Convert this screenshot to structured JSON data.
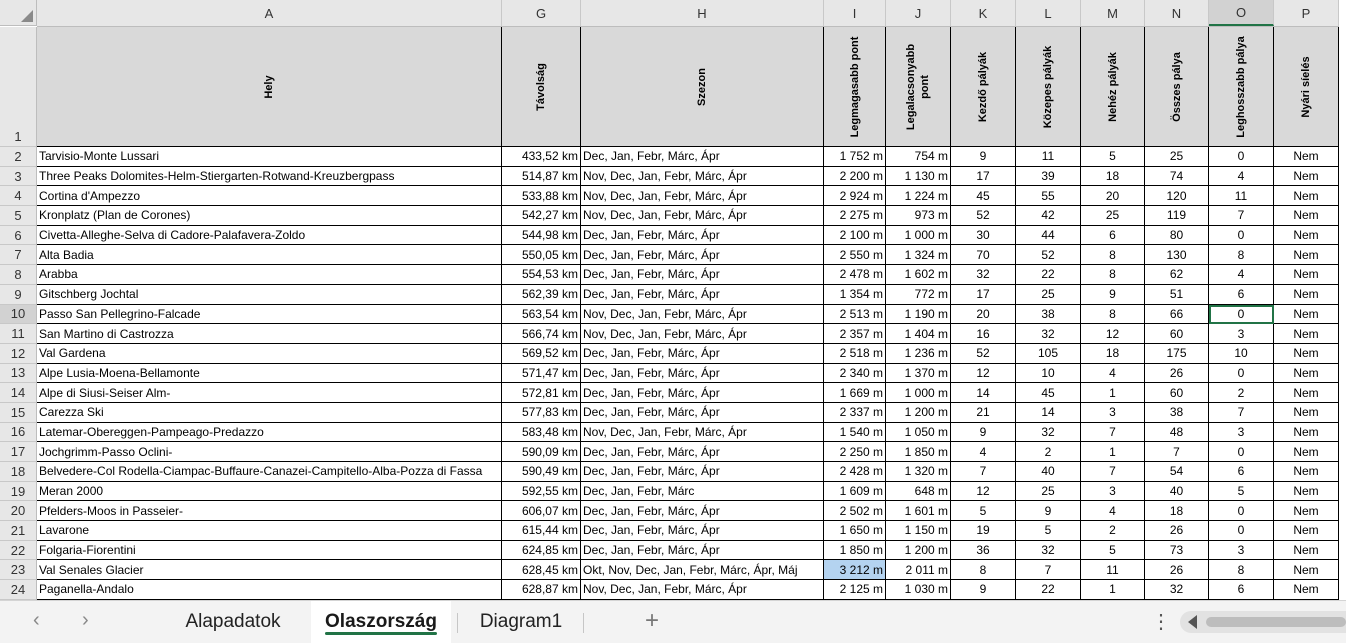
{
  "columns": [
    "A",
    "G",
    "H",
    "I",
    "J",
    "K",
    "L",
    "M",
    "N",
    "O",
    "P"
  ],
  "headers": [
    "Hely",
    "Távolság",
    "Szezon",
    "Legmagasabb pont",
    "Legalacsonyabb pont",
    "Kezdő pályák",
    "Közepes pályák",
    "Nehéz pályák",
    "Összes pálya",
    "Leghosszabb pálya",
    "Nyári síelés"
  ],
  "header_row_number": "1",
  "rows": [
    {
      "n": "2",
      "c": [
        "Tarvisio-Monte Lussari",
        "433,52 km",
        "Dec, Jan, Febr, Márc, Ápr",
        "1 752 m",
        "754 m",
        "9",
        "11",
        "5",
        "25",
        "0",
        "Nem"
      ]
    },
    {
      "n": "3",
      "c": [
        "Three Peaks Dolomites-Helm-Stiergarten-Rotwand-Kreuzbergpass",
        "514,87 km",
        "Nov, Dec, Jan, Febr, Márc, Ápr",
        "2 200 m",
        "1 130 m",
        "17",
        "39",
        "18",
        "74",
        "4",
        "Nem"
      ]
    },
    {
      "n": "4",
      "c": [
        "Cortina d'Ampezzo",
        "533,88 km",
        "Nov, Dec, Jan, Febr, Márc, Ápr",
        "2 924 m",
        "1 224 m",
        "45",
        "55",
        "20",
        "120",
        "11",
        "Nem"
      ]
    },
    {
      "n": "5",
      "c": [
        "Kronplatz (Plan de Corones)",
        "542,27 km",
        "Nov, Dec, Jan, Febr, Márc, Ápr",
        "2 275 m",
        "973 m",
        "52",
        "42",
        "25",
        "119",
        "7",
        "Nem"
      ]
    },
    {
      "n": "6",
      "c": [
        "Civetta-Alleghe-Selva di Cadore-Palafavera-Zoldo",
        "544,98 km",
        "Dec, Jan, Febr, Márc, Ápr",
        "2 100 m",
        "1 000 m",
        "30",
        "44",
        "6",
        "80",
        "0",
        "Nem"
      ]
    },
    {
      "n": "7",
      "c": [
        "Alta Badia",
        "550,05 km",
        "Dec, Jan, Febr, Márc, Ápr",
        "2 550 m",
        "1 324 m",
        "70",
        "52",
        "8",
        "130",
        "8",
        "Nem"
      ]
    },
    {
      "n": "8",
      "c": [
        "Arabba",
        "554,53 km",
        "Dec, Jan, Febr, Márc, Ápr",
        "2 478 m",
        "1 602 m",
        "32",
        "22",
        "8",
        "62",
        "4",
        "Nem"
      ]
    },
    {
      "n": "9",
      "c": [
        "Gitschberg Jochtal",
        "562,39 km",
        "Dec, Jan, Febr, Márc, Ápr",
        "1 354 m",
        "772 m",
        "17",
        "25",
        "9",
        "51",
        "6",
        "Nem"
      ]
    },
    {
      "n": "10",
      "c": [
        "Passo San Pellegrino-Falcade",
        "563,54 km",
        "Nov, Dec, Jan, Febr, Márc, Ápr",
        "2 513 m",
        "1 190 m",
        "20",
        "38",
        "8",
        "66",
        "0",
        "Nem"
      ]
    },
    {
      "n": "11",
      "c": [
        "San Martino di Castrozza",
        "566,74 km",
        "Nov, Dec, Jan, Febr, Márc, Ápr",
        "2 357 m",
        "1 404 m",
        "16",
        "32",
        "12",
        "60",
        "3",
        "Nem"
      ]
    },
    {
      "n": "12",
      "c": [
        "Val Gardena",
        "569,52 km",
        "Dec, Jan, Febr, Márc, Ápr",
        "2 518 m",
        "1 236 m",
        "52",
        "105",
        "18",
        "175",
        "10",
        "Nem"
      ]
    },
    {
      "n": "13",
      "c": [
        "Alpe Lusia-Moena-Bellamonte",
        "571,47 km",
        "Dec, Jan, Febr, Márc, Ápr",
        "2 340 m",
        "1 370 m",
        "12",
        "10",
        "4",
        "26",
        "0",
        "Nem"
      ]
    },
    {
      "n": "14",
      "c": [
        "Alpe di Siusi-Seiser Alm-",
        "572,81 km",
        "Dec, Jan, Febr, Márc, Ápr",
        "1 669 m",
        "1 000 m",
        "14",
        "45",
        "1",
        "60",
        "2",
        "Nem"
      ]
    },
    {
      "n": "15",
      "c": [
        "Carezza Ski",
        "577,83 km",
        "Dec, Jan, Febr, Márc, Ápr",
        "2 337 m",
        "1 200 m",
        "21",
        "14",
        "3",
        "38",
        "7",
        "Nem"
      ]
    },
    {
      "n": "16",
      "c": [
        "Latemar-Obereggen-Pampeago-Predazzo",
        "583,48 km",
        "Nov, Dec, Jan, Febr, Márc, Ápr",
        "1 540 m",
        "1 050 m",
        "9",
        "32",
        "7",
        "48",
        "3",
        "Nem"
      ]
    },
    {
      "n": "17",
      "c": [
        "Jochgrimm-Passo Oclini-",
        "590,09 km",
        "Dec, Jan, Febr, Márc, Ápr",
        "2 250 m",
        "1 850 m",
        "4",
        "2",
        "1",
        "7",
        "0",
        "Nem"
      ]
    },
    {
      "n": "18",
      "c": [
        "Belvedere-Col Rodella-Ciampac-Buffaure-Canazei-Campitello-Alba-Pozza di Fassa",
        "590,49 km",
        "Dec, Jan, Febr, Márc, Ápr",
        "2 428 m",
        "1 320 m",
        "7",
        "40",
        "7",
        "54",
        "6",
        "Nem"
      ]
    },
    {
      "n": "19",
      "c": [
        "Meran 2000",
        "592,55 km",
        "Dec, Jan, Febr, Márc",
        "1 609 m",
        "648 m",
        "12",
        "25",
        "3",
        "40",
        "5",
        "Nem"
      ]
    },
    {
      "n": "20",
      "c": [
        "Pfelders-Moos in Passeier-",
        "606,07 km",
        "Dec, Jan, Febr, Márc, Ápr",
        "2 502 m",
        "1 601 m",
        "5",
        "9",
        "4",
        "18",
        "0",
        "Nem"
      ]
    },
    {
      "n": "21",
      "c": [
        "Lavarone",
        "615,44 km",
        "Dec, Jan, Febr, Márc, Ápr",
        "1 650 m",
        "1 150 m",
        "19",
        "5",
        "2",
        "26",
        "0",
        "Nem"
      ]
    },
    {
      "n": "22",
      "c": [
        "Folgaria-Fiorentini",
        "624,85 km",
        "Dec, Jan, Febr, Márc, Ápr",
        "1 850 m",
        "1 200 m",
        "36",
        "32",
        "5",
        "73",
        "3",
        "Nem"
      ]
    },
    {
      "n": "23",
      "c": [
        "Val Senales Glacier",
        "628,45 km",
        "Okt, Nov, Dec, Jan, Febr, Márc, Ápr, Máj",
        "3 212 m",
        "2 011 m",
        "8",
        "7",
        "11",
        "26",
        "8",
        "Nem"
      ]
    },
    {
      "n": "24",
      "c": [
        "Paganella-Andalo",
        "628,87 km",
        "Nov, Dec, Jan, Febr, Márc, Ápr",
        "2 125 m",
        "1 030 m",
        "9",
        "22",
        "1",
        "32",
        "6",
        "Nem"
      ]
    }
  ],
  "selection": {
    "active_row": "10",
    "active_col": "O",
    "highlight_row": "23",
    "highlight_col": "I"
  },
  "tabs": [
    {
      "label": "Alapadatok",
      "active": false
    },
    {
      "label": "Olaszország",
      "active": true
    },
    {
      "label": "Diagram1",
      "active": false
    }
  ],
  "icons": {
    "prev": "chevron-left-icon",
    "next": "chevron-right-icon",
    "add": "plus-icon",
    "more": "vertical-dots-icon"
  },
  "colors": {
    "accent": "#217346",
    "highlight": "#b4d3f0",
    "header_fill": "#d9d9d9"
  }
}
